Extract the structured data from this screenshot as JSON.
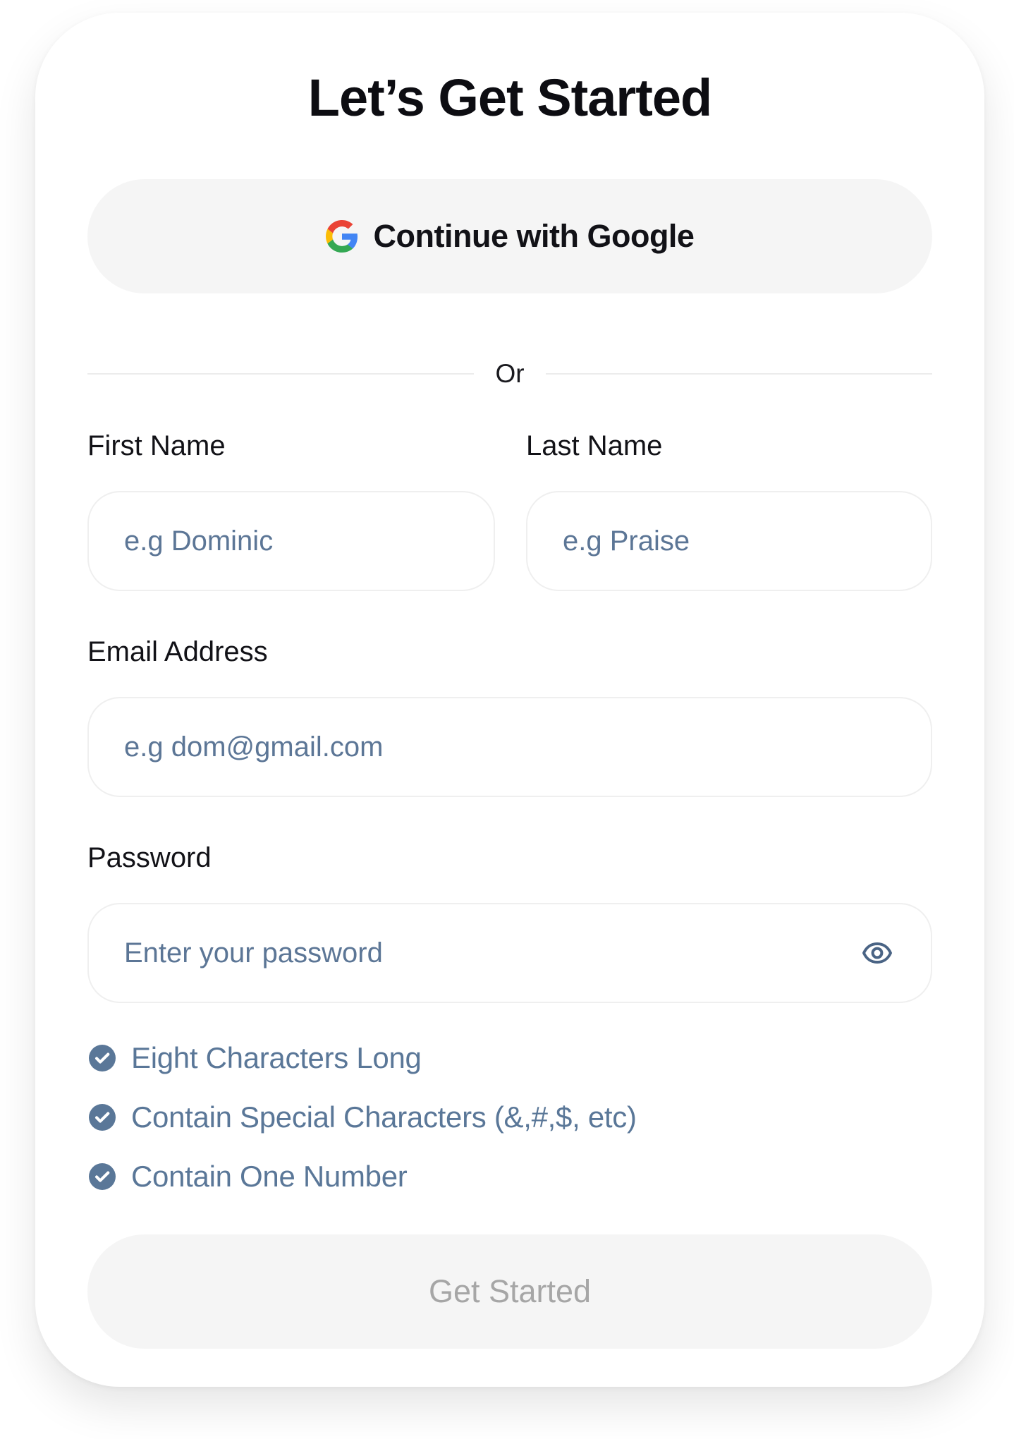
{
  "title": "Let’s Get Started",
  "google_button": {
    "label": "Continue with Google",
    "icon": "google-g-icon"
  },
  "divider_text": "Or",
  "fields": {
    "first_name": {
      "label": "First Name",
      "placeholder": "e.g Dominic"
    },
    "last_name": {
      "label": "Last Name",
      "placeholder": "e.g Praise"
    },
    "email": {
      "label": "Email Address",
      "placeholder": "e.g dom@gmail.com"
    },
    "password": {
      "label": "Password",
      "placeholder": "Enter your password",
      "toggle_icon": "eye-icon"
    }
  },
  "requirements": [
    {
      "text": "Eight Characters Long",
      "icon": "check-circle-icon"
    },
    {
      "text": "Contain Special Characters (&,#,$, etc)",
      "icon": "check-circle-icon"
    },
    {
      "text": "Contain One Number",
      "icon": "check-circle-icon"
    }
  ],
  "submit_button": {
    "label": "Get Started"
  },
  "colors": {
    "title": "#0d0d12",
    "button_bg": "#f5f5f5",
    "placeholder": "#5c7696",
    "check": "#5a7798",
    "disabled_text": "#a6a6a6"
  }
}
